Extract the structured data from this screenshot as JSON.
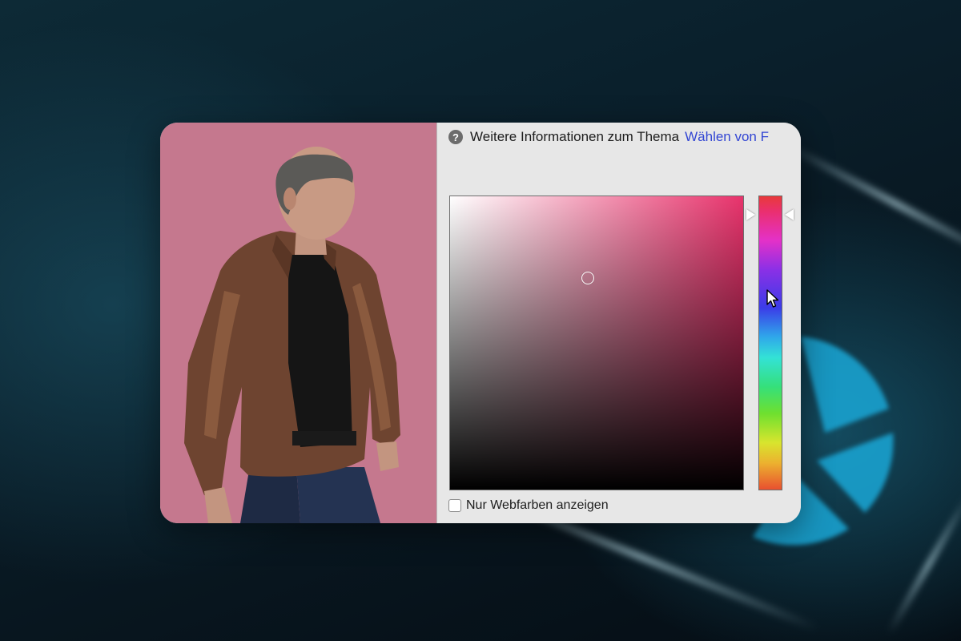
{
  "help": {
    "icon": "question-icon",
    "text": "Weitere Informationen zum Thema",
    "link": "Wählen von F"
  },
  "color_picker": {
    "hue_color": "#e8336c",
    "web_colors_checked": false,
    "web_colors_label": "Nur Webfarben anzeigen"
  },
  "photo": {
    "background_color": "#c5788e",
    "description_icon": "person-photo"
  }
}
